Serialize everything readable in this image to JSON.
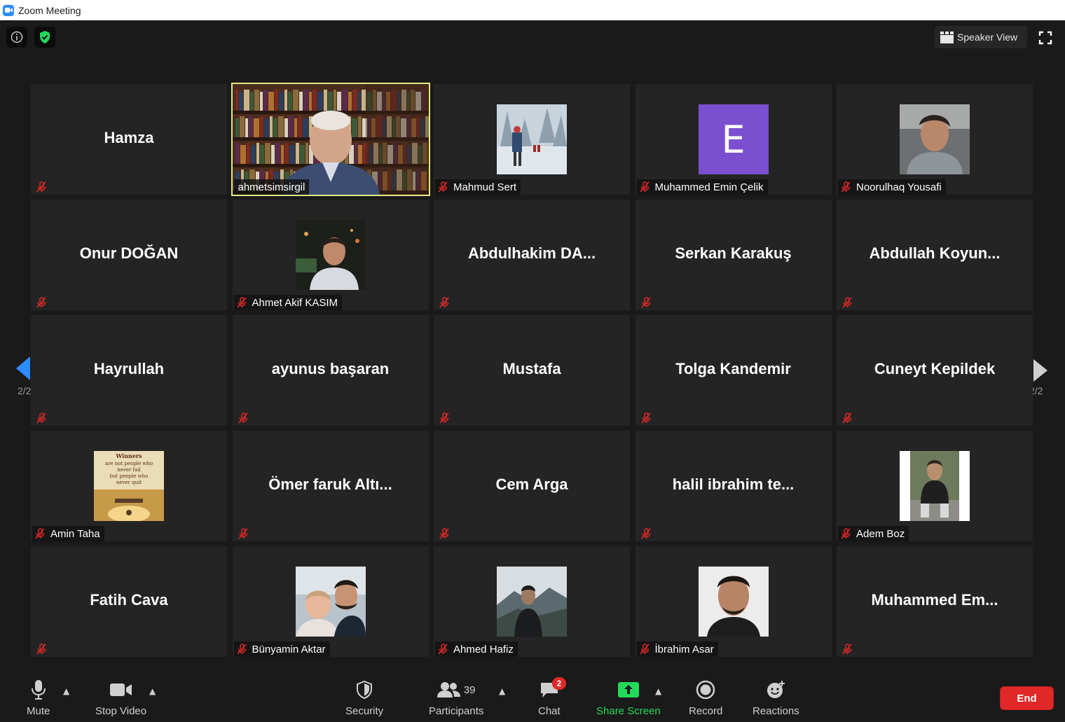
{
  "window": {
    "title": "Zoom Meeting"
  },
  "top_controls": {
    "speaker_view_label": "Speaker View"
  },
  "grid": {
    "tiles": [
      {
        "name": "Hamza",
        "kind": "name",
        "muted": true
      },
      {
        "name": "ahmetsimsirgil",
        "kind": "video",
        "muted": false,
        "active_speaker": true
      },
      {
        "name": "Mahmud Sert",
        "kind": "photo",
        "muted": true,
        "photo": "snowy-forest-hikers"
      },
      {
        "name": "Muhammed Emin Çelik",
        "kind": "avatar",
        "muted": true,
        "avatar_letter": "E",
        "avatar_color": "#7b4fd0"
      },
      {
        "name": "Noorulhaq Yousafi",
        "kind": "photo",
        "muted": true,
        "photo": "young-man-portrait"
      },
      {
        "name": "Onur DOĞAN",
        "kind": "name",
        "muted": true
      },
      {
        "name": "Ahmet Akif KASIM",
        "kind": "photo",
        "muted": true,
        "photo": "man-night-city"
      },
      {
        "name": "Abdulhakim  DA...",
        "kind": "name",
        "muted": true
      },
      {
        "name": "Serkan Karakuş",
        "kind": "name",
        "muted": true
      },
      {
        "name": "Abdullah  Koyun...",
        "kind": "name",
        "muted": true
      },
      {
        "name": "Hayrullah",
        "kind": "name",
        "muted": true
      },
      {
        "name": "ayunus başaran",
        "kind": "name",
        "muted": true
      },
      {
        "name": "Mustafa",
        "kind": "name",
        "muted": true
      },
      {
        "name": "Tolga Kandemir",
        "kind": "name",
        "muted": true
      },
      {
        "name": "Cuneyt Kepildek",
        "kind": "name",
        "muted": true
      },
      {
        "name": "Amin Taha",
        "kind": "photo",
        "muted": true,
        "photo": "winners-quote",
        "quote_lines": [
          "Winners",
          "are not people who",
          "never fail",
          "but people who",
          "never quit"
        ]
      },
      {
        "name": "Ömer  faruk  Altı...",
        "kind": "name",
        "muted": true
      },
      {
        "name": "Cem Arga",
        "kind": "name",
        "muted": true
      },
      {
        "name": "halil  ibrahim  te...",
        "kind": "name",
        "muted": true
      },
      {
        "name": "Adem Boz",
        "kind": "photo",
        "muted": true,
        "photo": "man-sitting-outdoors"
      },
      {
        "name": "Fatih Cava",
        "kind": "name",
        "muted": true
      },
      {
        "name": "Bünyamin Aktar",
        "kind": "photo",
        "muted": true,
        "photo": "father-and-child"
      },
      {
        "name": "Ahmed Hafiz",
        "kind": "photo",
        "muted": true,
        "photo": "man-mountain-mist"
      },
      {
        "name": "İbrahim Asar",
        "kind": "photo",
        "muted": true,
        "photo": "man-headshot"
      },
      {
        "name": "Muhammed  Em...",
        "kind": "name",
        "muted": true
      }
    ]
  },
  "pagination": {
    "left_page": "2/2",
    "right_page": "2/2"
  },
  "toolbar": {
    "mute_label": "Mute",
    "stop_video_label": "Stop Video",
    "security_label": "Security",
    "participants_label": "Participants",
    "participants_count": "39",
    "chat_label": "Chat",
    "chat_badge": "2",
    "share_screen_label": "Share Screen",
    "record_label": "Record",
    "reactions_label": "Reactions",
    "end_label": "End"
  },
  "colors": {
    "background": "#1a1a1a",
    "tile": "#242424",
    "active_speaker_border": "#e2e980",
    "share_green": "#23d959",
    "end_red": "#e02828",
    "nav_arrow_blue": "#2d8cff",
    "mute_icon_red": "#e02828"
  },
  "icons": {
    "info": "info-icon",
    "security_shield": "shield-check-icon",
    "speaker_view": "speaker-view-icon",
    "fullscreen": "fullscreen-icon",
    "muted": "mic-muted-icon",
    "prev_page": "arrow-left-icon",
    "next_page": "arrow-right-icon"
  }
}
